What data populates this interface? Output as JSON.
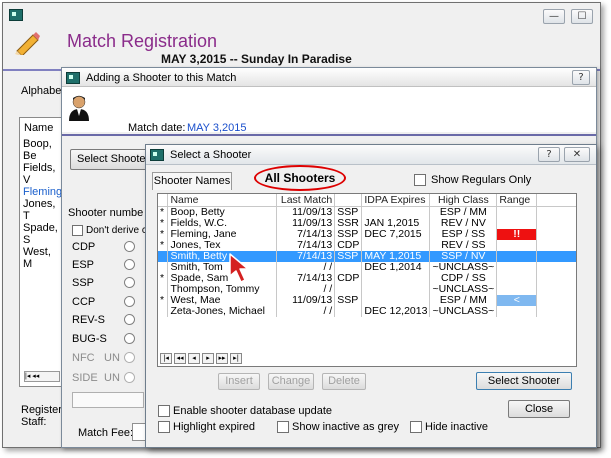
{
  "main": {
    "title": "Match Registration",
    "match_line": "MAY  3,2015 -- Sunday In Paradise",
    "alphabet_label": "Alphabet",
    "name_header": "Name",
    "names": [
      "Boop, Be",
      "Fields, V",
      "Fleming",
      "Jones, T",
      "Spade, S",
      "West, M"
    ],
    "registered_label": "Registere",
    "staff_label": "Staff:",
    "min_glyph": "—",
    "max_glyph": "☐",
    "close_glyph": "✕"
  },
  "adding": {
    "title": "Adding a Shooter to this Match",
    "help_glyph": "?",
    "match_date_label": "Match date:",
    "match_date_value": "MAY  3,2015",
    "select_shooter_button": "Select Shoote",
    "shooter_number_label": "Shooter numbe",
    "dont_derive_label": "Don't derive cl",
    "divisions": [
      "CDP",
      "ESP",
      "SSP",
      "CCP",
      "REV-S",
      "BUG-S",
      "NFC",
      "SIDE"
    ],
    "division_suffix": "UN",
    "match_fee_label": "Match Fee:"
  },
  "select": {
    "title": "Select a Shooter",
    "help_glyph": "?",
    "close_glyph": "✕",
    "tabs": [
      "Shooter Names",
      "All Shooters"
    ],
    "show_regulars_label": "Show Regulars Only",
    "columns": [
      "Name",
      "Last Match",
      "IDPA Expires",
      "High Class",
      "Range"
    ],
    "rows": [
      {
        "mark": "*",
        "name": "Boop, Betty",
        "last": "11/09/13",
        "div": "SSP",
        "expires": "",
        "class": "ESP / MM",
        "range": ""
      },
      {
        "mark": "*",
        "name": "Fields, W.C.",
        "last": "11/09/13",
        "div": "SSR",
        "expires": "JAN  1,2015",
        "class": "REV / NV",
        "range": ""
      },
      {
        "mark": "*",
        "name": "Fleming, Jane",
        "last": "7/14/13",
        "div": "SSP",
        "expires": "DEC  7,2015",
        "class": "ESP / SS",
        "range": "!!"
      },
      {
        "mark": "*",
        "name": "Jones, Tex",
        "last": "7/14/13",
        "div": "CDP",
        "expires": "",
        "class": "REV / SS",
        "range": ""
      },
      {
        "mark": "",
        "name": "Smith, Betty",
        "last": "7/14/13",
        "div": "SSP",
        "expires": "MAY  1,2015",
        "class": "SSP / NV",
        "range": ""
      },
      {
        "mark": "",
        "name": "Smith, Tom",
        "last": "/  /",
        "div": "",
        "expires": "DEC  1,2014",
        "class": "~UNCLASS~",
        "range": ""
      },
      {
        "mark": "*",
        "name": "Spade, Sam",
        "last": "7/14/13",
        "div": "CDP",
        "expires": "",
        "class": "CDP / SS",
        "range": ""
      },
      {
        "mark": "",
        "name": "Thompson, Tommy",
        "last": "/  /",
        "div": "",
        "expires": "",
        "class": "~UNCLASS~",
        "range": ""
      },
      {
        "mark": "*",
        "name": "West, Mae",
        "last": "11/09/13",
        "div": "SSP",
        "expires": "",
        "class": "ESP / MM",
        "range": "<"
      },
      {
        "mark": "",
        "name": "Zeta-Jones, Michael",
        "last": "/  /",
        "div": "",
        "expires": "DEC 12,2013",
        "class": "~UNCLASS~",
        "range": ""
      }
    ],
    "selected_row": 4,
    "nav_glyphs": [
      "|◂",
      "◂◂",
      "◂",
      "▸",
      "▸▸",
      "▸|"
    ],
    "insert_button": "Insert",
    "change_button": "Change",
    "delete_button": "Delete",
    "select_shooter_button": "Select Shooter",
    "close_button": "Close",
    "enable_update_label": "Enable shooter database update",
    "highlight_expired_label": "Highlight expired",
    "show_inactive_grey_label": "Show inactive as grey",
    "hide_inactive_label": "Hide inactive",
    "colors": {
      "alert_red": "#ee1111",
      "range_blue": "#7fb8f0",
      "selection": "#3399ff",
      "highlight_oval": "#dd0000",
      "cursor_red": "#d42020"
    }
  }
}
